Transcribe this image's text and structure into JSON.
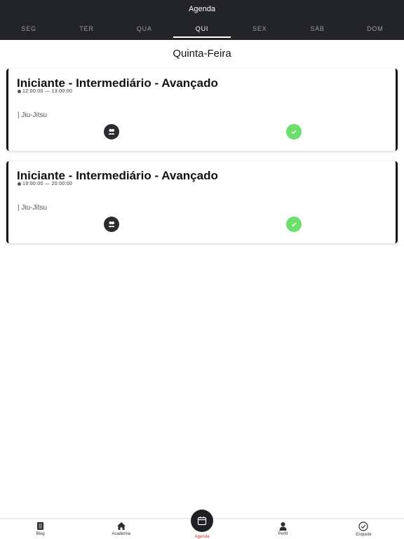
{
  "header": {
    "title": "Agenda"
  },
  "tabs": [
    {
      "label": "SEG"
    },
    {
      "label": "TER"
    },
    {
      "label": "QUA"
    },
    {
      "label": "QUI"
    },
    {
      "label": "SEX"
    },
    {
      "label": "SÁB"
    },
    {
      "label": "DOM"
    }
  ],
  "active_tab": "QUI",
  "day_title": "Quinta-Feira",
  "classes": [
    {
      "title": "Iniciante - Intermediário - Avançado",
      "time": "12:00:00 — 13:00:00",
      "category": "| Jiu-Jitsu"
    },
    {
      "title": "Iniciante - Intermediário - Avançado",
      "time": "19:00:00 — 20:00:00",
      "category": "| Jiu-Jitsu"
    }
  ],
  "nav": [
    {
      "label": "Blog",
      "icon": "book-icon"
    },
    {
      "label": "Academia",
      "icon": "home-icon"
    },
    {
      "label": "Agenda",
      "icon": "calendar-icon"
    },
    {
      "label": "Perfil",
      "icon": "user-icon"
    },
    {
      "label": "Enquete",
      "icon": "check-circle-icon"
    }
  ],
  "colors": {
    "header": "#232428",
    "check": "#6cde6b",
    "active_nav": "#d62b2b"
  }
}
